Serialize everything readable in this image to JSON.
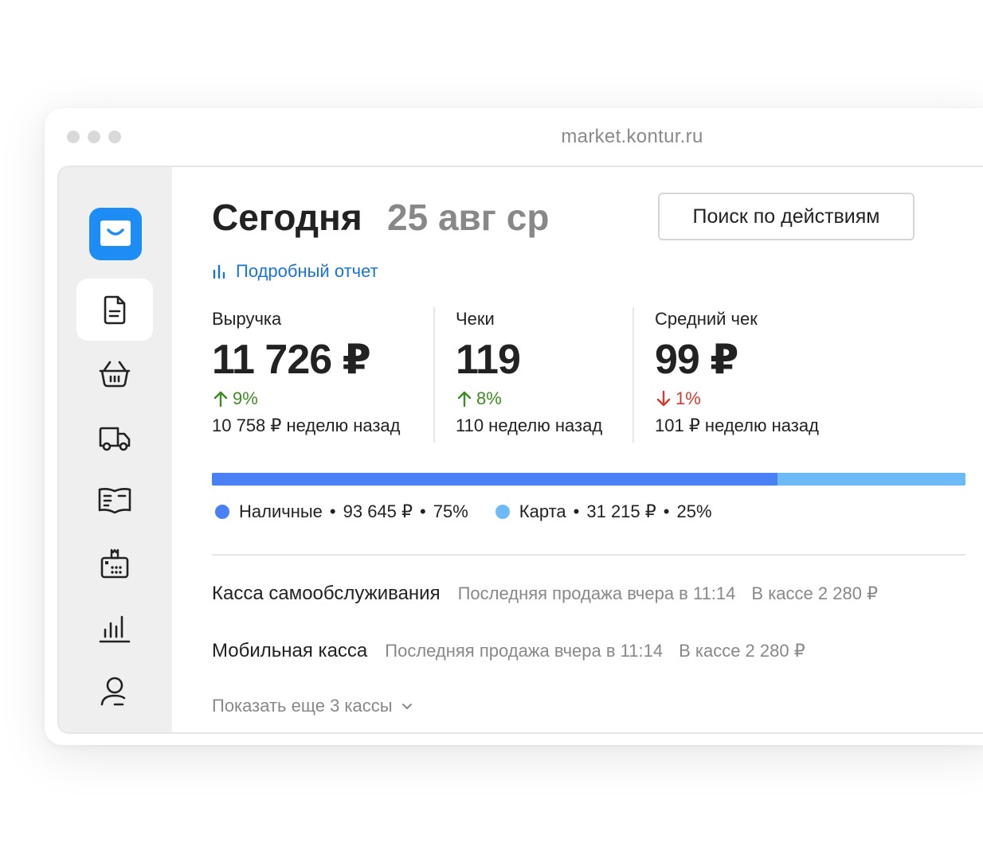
{
  "browser": {
    "url": "market.kontur.ru"
  },
  "sidebar": {
    "items": [
      {
        "icon": "document-icon",
        "active": true
      },
      {
        "icon": "basket-icon",
        "active": false
      },
      {
        "icon": "truck-icon",
        "active": false
      },
      {
        "icon": "book-icon",
        "active": false
      },
      {
        "icon": "cash-register-icon",
        "active": false
      },
      {
        "icon": "bar-chart-icon",
        "active": false
      },
      {
        "icon": "user-icon",
        "active": false
      }
    ]
  },
  "header": {
    "title": "Сегодня",
    "date": "25 авг ср",
    "search_button": "Поиск по действиям",
    "report_link": "Подробный отчет"
  },
  "metrics": [
    {
      "label": "Выручка",
      "value": "11 726 ₽",
      "change": "9%",
      "direction": "up",
      "previous": "10 758 ₽ неделю назад"
    },
    {
      "label": "Чеки",
      "value": "119",
      "change": "8%",
      "direction": "up",
      "previous": "110 неделю назад"
    },
    {
      "label": "Средний чек",
      "value": "99 ₽",
      "change": "1%",
      "direction": "down",
      "previous": "101 ₽ неделю назад"
    }
  ],
  "payment_split": {
    "cash": {
      "label": "Наличные",
      "amount": "93 645 ₽",
      "percent": "75%",
      "share": 0.75,
      "color": "#4a80f5"
    },
    "card": {
      "label": "Карта",
      "amount": "31 215 ₽",
      "percent": "25%",
      "share": 0.25,
      "color": "#6dbaf8"
    }
  },
  "kassas": [
    {
      "name": "Касса самообслуживания",
      "last_sale": "Последняя продажа вчера в 11:14",
      "balance": "В кассе 2 280 ₽"
    },
    {
      "name": "Мобильная касса",
      "last_sale": "Последняя продажа вчера в 11:14",
      "balance": "В кассе 2 280 ₽"
    }
  ],
  "show_more": "Показать еще 3 кассы",
  "colors": {
    "accent": "#1e8cf5",
    "link": "#1a73d9",
    "up": "#3d8b22",
    "down": "#d23b2e"
  }
}
